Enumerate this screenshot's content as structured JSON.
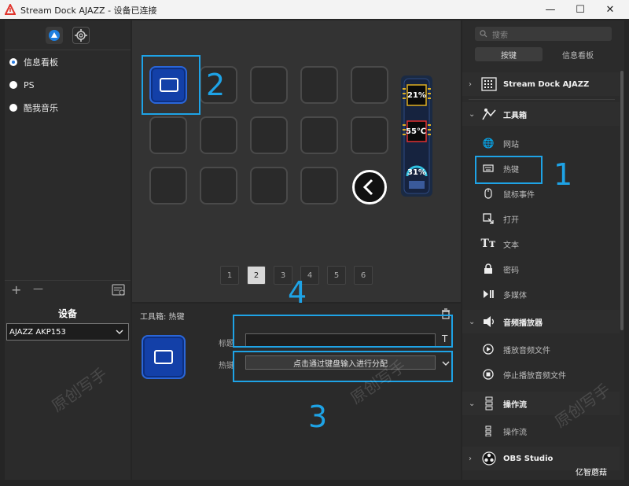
{
  "window": {
    "title": "Stream Dock AJAZZ - 设备已连接",
    "minimize": "—",
    "maximize": "☐",
    "close": "✕"
  },
  "left_panel": {
    "profiles": [
      {
        "label": "信息看板",
        "selected": true
      },
      {
        "label": "PS",
        "selected": false
      },
      {
        "label": "酷我音乐",
        "selected": false
      }
    ],
    "add": "+",
    "remove": "—",
    "device_heading": "设备",
    "device_selected": "AJAZZ AKP153"
  },
  "center": {
    "pages": [
      "1",
      "2",
      "3",
      "4",
      "5",
      "6"
    ],
    "active_page": "2",
    "widget": {
      "cpu": "21%",
      "temp": "55℃",
      "gpu": "31%"
    }
  },
  "properties": {
    "header": "工具箱: 热键",
    "title_label": "标题",
    "title_value": "",
    "title_type_icon": "T",
    "hotkey_label": "热键",
    "hotkey_placeholder": "点击通过键盘输入进行分配"
  },
  "annotations": {
    "n1": "1",
    "n2": "2",
    "n3": "3",
    "n4": "4"
  },
  "right_panel": {
    "search_placeholder": "搜索",
    "tabs": [
      "按键",
      "信息看板"
    ],
    "categories": {
      "stream_dock": "Stream Dock AJAZZ",
      "toolbox": "工具箱",
      "audio": "音频播放器",
      "flow": "操作流",
      "obs": "OBS Studio"
    },
    "toolbox_items": [
      "网站",
      "热键",
      "鼠标事件",
      "打开",
      "文本",
      "密码",
      "多媒体"
    ],
    "audio_items": [
      "播放音频文件",
      "停止播放音频文件"
    ],
    "flow_items": [
      "操作流"
    ]
  },
  "watermarks": {
    "text": "原创写手",
    "brand": "亿智蘑菇"
  },
  "colors": {
    "accent": "#1ea3e6",
    "key_blue": "#1340a8",
    "panel": "#2b2b2b"
  }
}
